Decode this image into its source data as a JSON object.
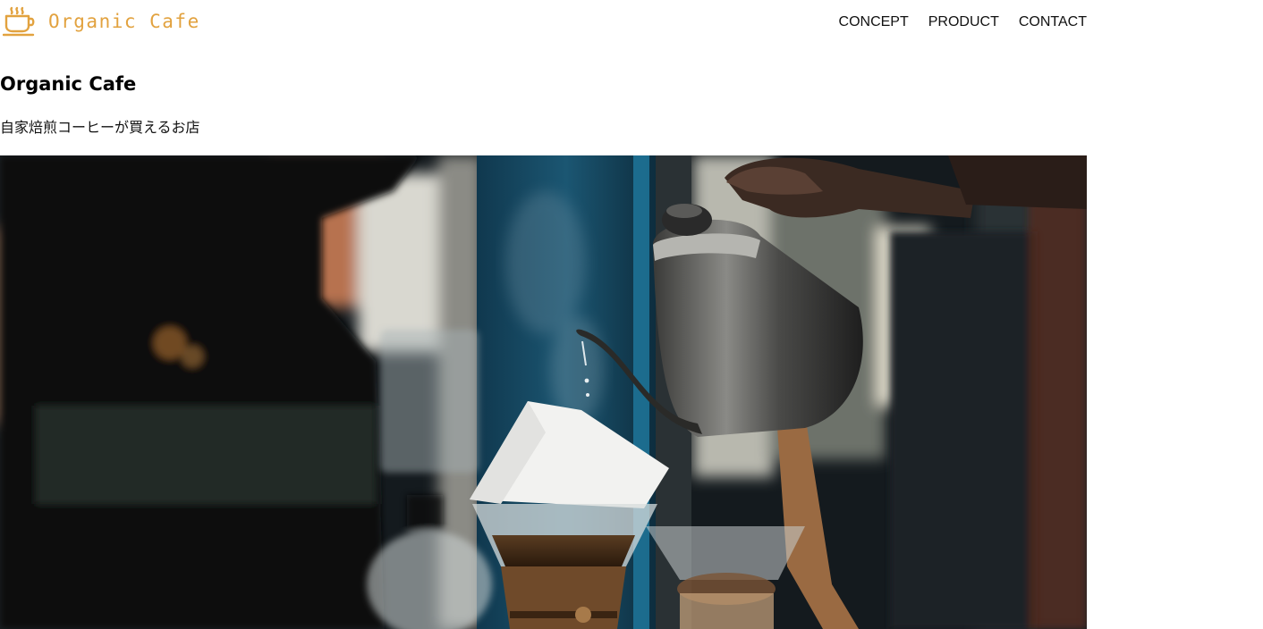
{
  "header": {
    "logo_text": "Organic Cafe",
    "logo_icon": "coffee-cup-icon",
    "nav": [
      {
        "label": "CONCEPT"
      },
      {
        "label": "PRODUCT"
      },
      {
        "label": "CONTACT"
      }
    ]
  },
  "main": {
    "title": "Organic Cafe",
    "subtitle": "自家焙煎コーヒーが買えるお店"
  },
  "colors": {
    "brand": "#e2a23f",
    "text": "#111111",
    "background": "#ffffff"
  }
}
